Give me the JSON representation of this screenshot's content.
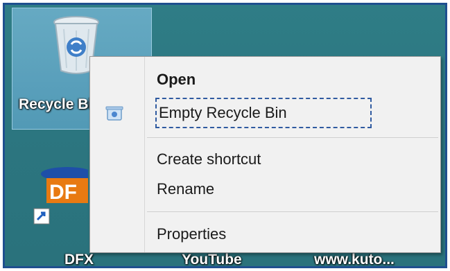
{
  "desktop": {
    "icons": [
      {
        "label": "Recycle Bin",
        "icon": "recycle-bin-icon"
      },
      {
        "label": "DFX",
        "icon": "dfx-icon"
      },
      {
        "label": "YouTube",
        "icon": "youtube-icon"
      },
      {
        "label": "www.kuto...",
        "icon": "shortcut-icon"
      }
    ]
  },
  "context_menu": {
    "items": [
      {
        "label": "Open",
        "bold": true
      },
      {
        "label": "Empty Recycle Bin",
        "icon": "recycle-bin-small-icon",
        "highlighted": true
      },
      {
        "label": "Create shortcut"
      },
      {
        "label": "Rename"
      },
      {
        "label": "Properties"
      }
    ]
  },
  "colors": {
    "desktop_bg": "#2c7680",
    "menu_bg": "#f1f1f1",
    "focus_outline": "#2f5aa0",
    "frame_border": "#1f4f8f"
  }
}
